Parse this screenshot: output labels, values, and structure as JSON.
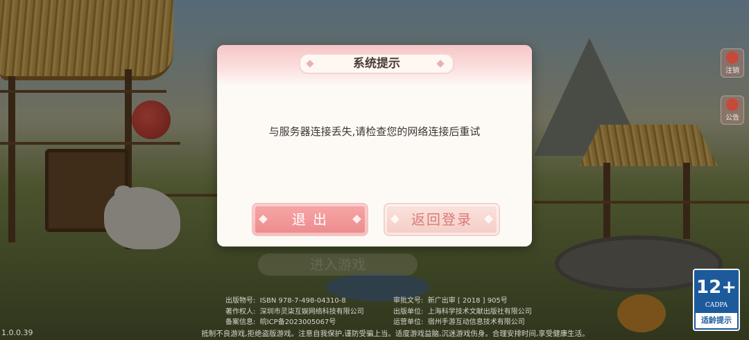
{
  "background": {
    "entry_button_label": "进入游戏"
  },
  "side_buttons": [
    {
      "label": "注销",
      "icon": "logout-icon"
    },
    {
      "label": "公告",
      "icon": "announcement-icon"
    }
  ],
  "publication_info": {
    "left": [
      {
        "key": "出版物号:",
        "value": "ISBN 978-7-498-04310-8"
      },
      {
        "key": "著作权人:",
        "value": "深圳市灵柒互娱网络科技有限公司"
      },
      {
        "key": "备案信息:",
        "value": "皖ICP备2023005067号"
      }
    ],
    "right": [
      {
        "key": "审批文号:",
        "value": "新广出审 [ 2018 ] 905号"
      },
      {
        "key": "出版单位:",
        "value": "上海科学技术文献出版社有限公司"
      },
      {
        "key": "运营单位:",
        "value": "宿州手游互动信息技术有限公司"
      }
    ]
  },
  "version": "1.0.0.39",
  "footer_notice": "抵制不良游戏,拒绝盗版游戏。注意自我保护,谨防受骗上当。适度游戏益脑,沉迷游戏伤身。合理安排时间,享受健康生活。",
  "age_rating": {
    "number": "12+",
    "org": "CADPA",
    "tip": "适龄提示",
    "color": "#1d5a9c"
  },
  "dialog": {
    "title": "系统提示",
    "message": "与服务器连接丢失,请检查您的网络连接后重试",
    "exit_label": "退 出",
    "return_login_label": "返回登录",
    "accent": "#ec8a8c"
  }
}
